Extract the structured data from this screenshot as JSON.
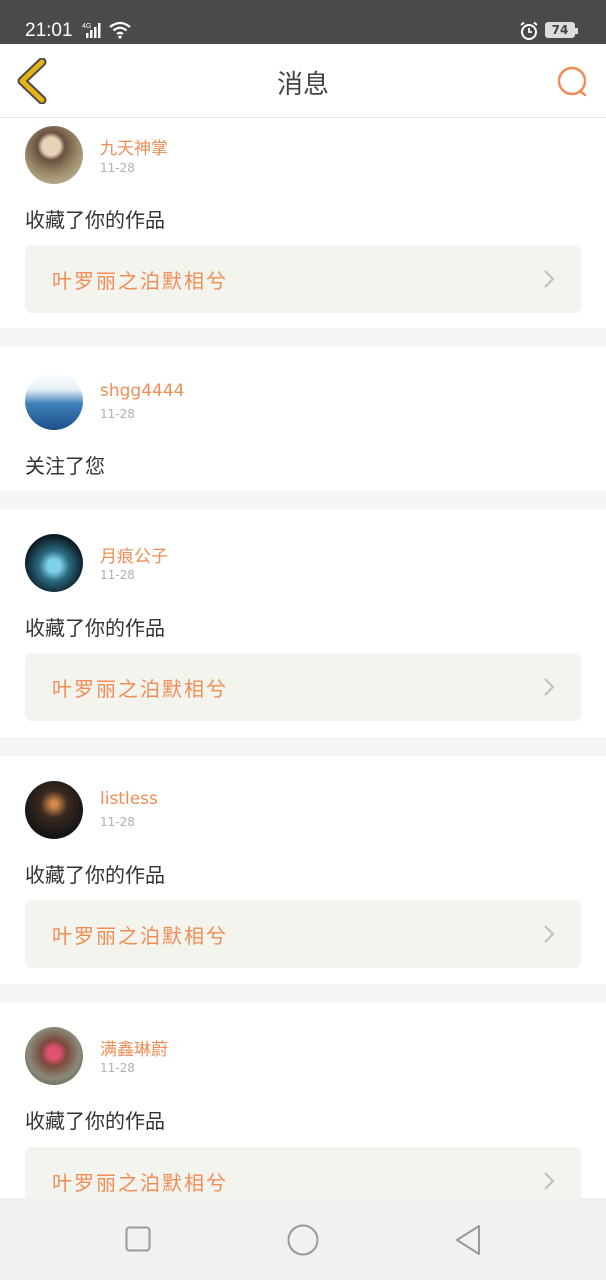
{
  "status_bar": {
    "time": "21:01",
    "network": "4G",
    "battery": "74"
  },
  "header": {
    "title": "消息",
    "accent_color": "#ef8d55",
    "back_color": "#e7b415"
  },
  "messages": [
    {
      "username": "九天神掌",
      "date": "11-28",
      "action": "收藏了你的作品",
      "work_title": "叶罗丽之泊默相兮"
    },
    {
      "username": "shgg4444",
      "date": "11-28",
      "action": "关注了您"
    },
    {
      "username": "月痕公子",
      "date": "11-28",
      "action": "收藏了你的作品",
      "work_title": "叶罗丽之泊默相兮"
    },
    {
      "username": "listless",
      "date": "11-28",
      "action": "收藏了你的作品",
      "work_title": "叶罗丽之泊默相兮"
    },
    {
      "username": "满鑫琳蔚",
      "date": "11-28",
      "action": "收藏了你的作品",
      "work_title": "叶罗丽之泊默相兮"
    }
  ],
  "nav_bar": {
    "icons": [
      "recent-apps-icon",
      "home-icon",
      "back-icon"
    ]
  }
}
